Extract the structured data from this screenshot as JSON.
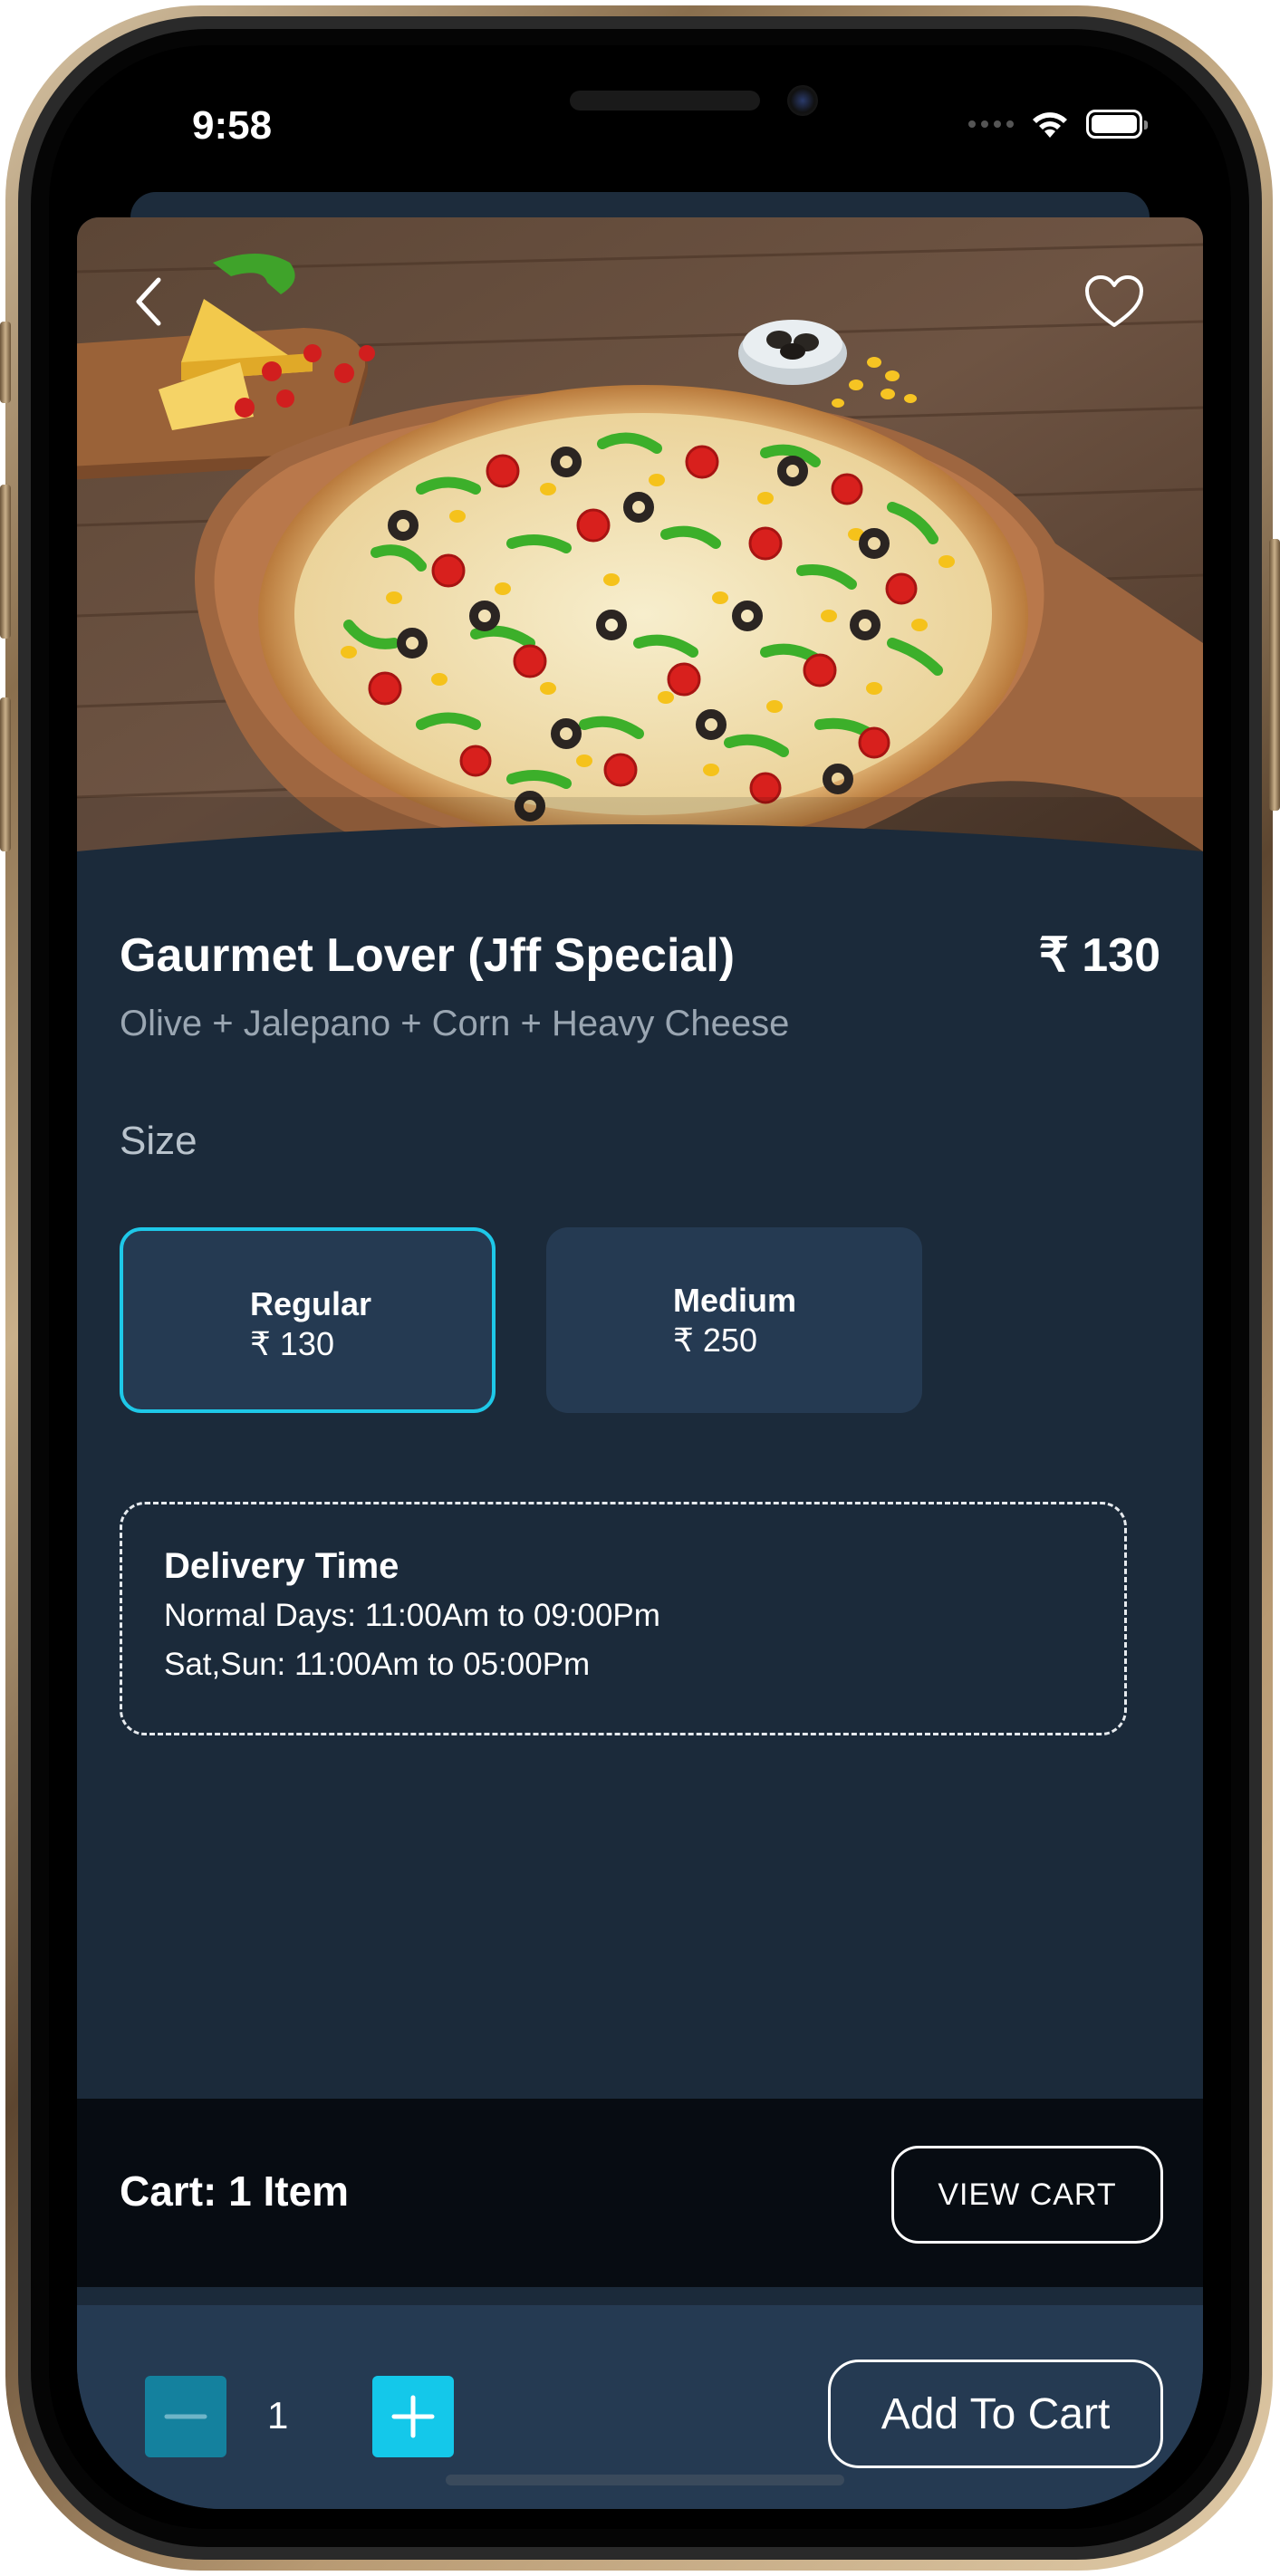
{
  "status_bar": {
    "time": "9:58",
    "icons": [
      "wifi-icon",
      "battery-icon"
    ]
  },
  "product": {
    "title": "Gaurmet Lover (Jff Special)",
    "price": "₹ 130",
    "description": "Olive + Jalepano + Corn + Heavy Cheese",
    "image": "pizza-image"
  },
  "size": {
    "label": "Size",
    "options": [
      {
        "name": "Regular",
        "price": "₹ 130",
        "selected": true
      },
      {
        "name": "Medium",
        "price": "₹ 250",
        "selected": false
      }
    ]
  },
  "delivery": {
    "title": "Delivery Time",
    "lines": [
      "Normal Days: 11:00Am to 09:00Pm",
      "Sat,Sun: 11:00Am to 05:00Pm"
    ]
  },
  "cart": {
    "summary": "Cart: 1 Item",
    "view_label": "VIEW CART"
  },
  "order": {
    "quantity": "1",
    "add_label": "Add To Cart"
  },
  "colors": {
    "background": "#1b2a3a",
    "surface": "#253a52",
    "accent": "#14c8ea",
    "cart_bar": "#070c12"
  }
}
